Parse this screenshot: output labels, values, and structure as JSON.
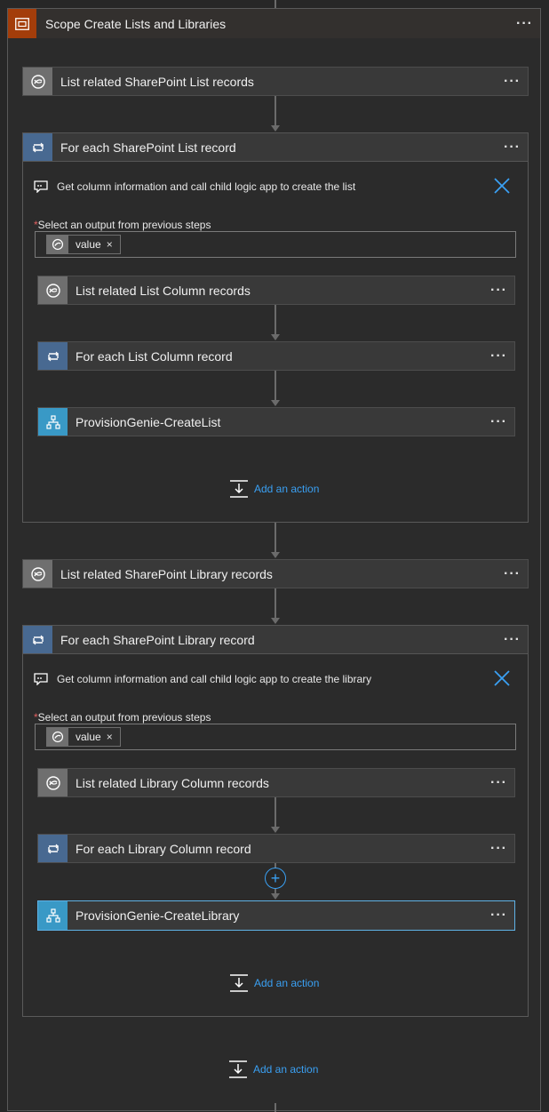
{
  "scope": {
    "title": "Scope Create Lists and Libraries"
  },
  "list_section": {
    "list_records": "List related SharePoint List records",
    "foreach": "For each SharePoint List record",
    "comment": "Get column information and call child logic app to create the list",
    "select_label": "Select an output from previous steps",
    "token": "value",
    "column_records": "List related List Column records",
    "foreach_column": "For each List Column record",
    "child_app": "ProvisionGenie-CreateList",
    "add_action": "Add an action"
  },
  "library_section": {
    "list_records": "List related SharePoint Library records",
    "foreach": "For each SharePoint Library record",
    "comment": "Get column information and call child logic app to create the library",
    "select_label": "Select an output from previous steps",
    "token": "value",
    "column_records": "List related Library Column records",
    "foreach_column": "For each Library Column record",
    "child_app": "ProvisionGenie-CreateLibrary",
    "add_action": "Add an action"
  },
  "bottom": {
    "add_action": "Add an action"
  },
  "more_label": "···",
  "token_close": "×",
  "required_mark": "*",
  "colors": {
    "scope_icon": "#a33d0a",
    "dataverse_icon": "#6f6f6f",
    "foreach_icon": "#486991",
    "logicapp_icon": "#3999c6",
    "link": "#3aa0f3"
  }
}
